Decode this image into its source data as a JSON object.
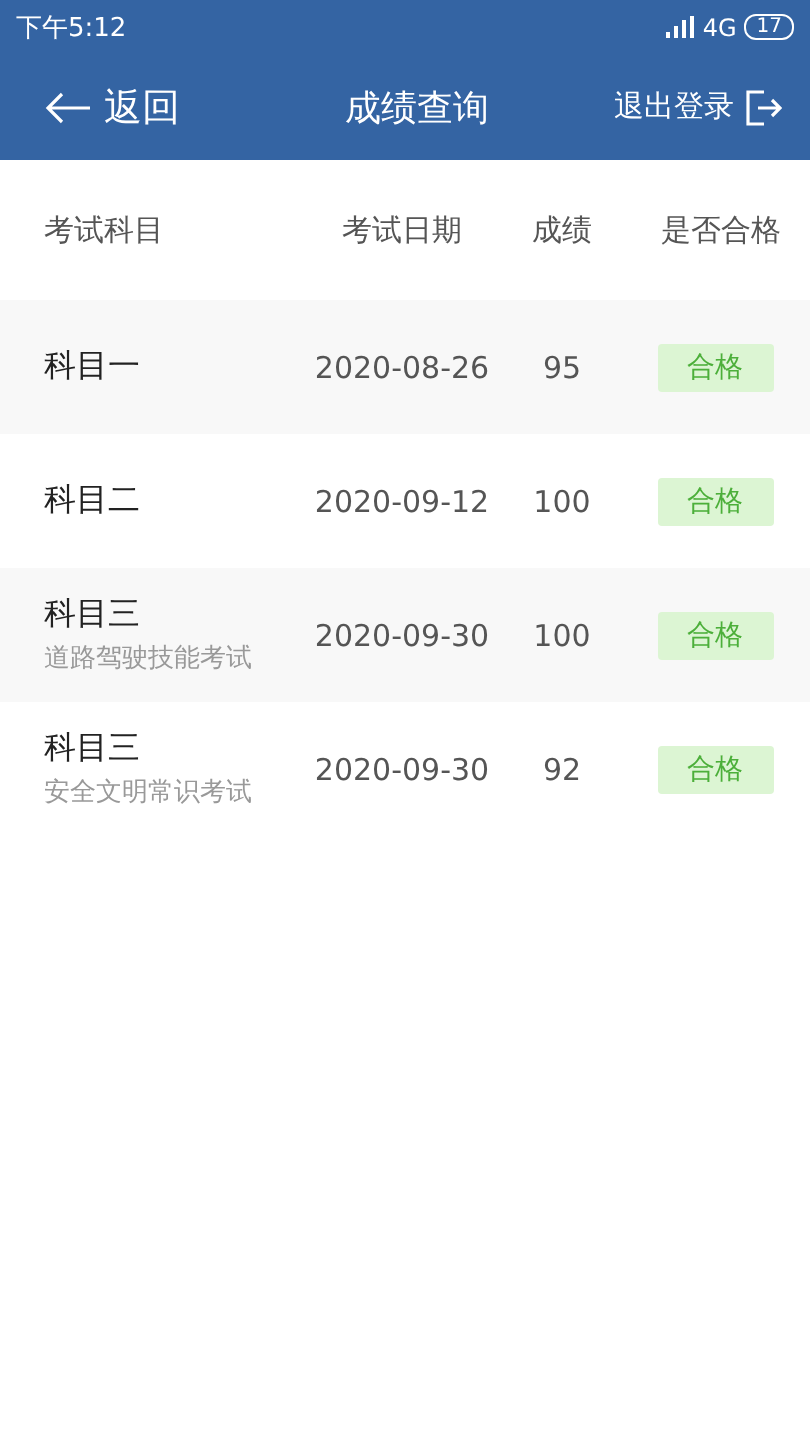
{
  "status_bar": {
    "time": "下午5:12",
    "network": "4G",
    "battery": "17"
  },
  "header": {
    "back": "返回",
    "title": "成绩查询",
    "logout": "退出登录"
  },
  "table": {
    "columns": [
      "考试科目",
      "考试日期",
      "成绩",
      "是否合格"
    ],
    "rows": [
      {
        "subject": "科目一",
        "date": "2020-08-26",
        "score": "95",
        "result": "合格",
        "passed": true
      },
      {
        "subject": "科目二",
        "date": "2020-09-12",
        "score": "100",
        "result": "合格",
        "passed": true
      },
      {
        "subject": "科目三",
        "note": "道路驾驶技能考试",
        "date": "2020-09-30",
        "score": "100",
        "result": "合格",
        "passed": true
      },
      {
        "subject": "科目三",
        "note": "安全文明常识考试",
        "date": "2020-09-30",
        "score": "92",
        "result": "合格",
        "passed": true
      }
    ]
  }
}
